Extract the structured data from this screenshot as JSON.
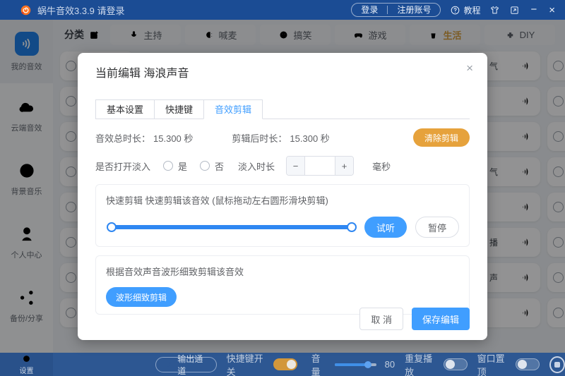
{
  "titlebar": {
    "title": "蜗牛音效3.3.9 请登录",
    "login": "登录",
    "register": "注册账号",
    "help": "教程",
    "icons": [
      "snail-logo",
      "question-circle-icon",
      "skin-theme-icon",
      "resize-window-icon",
      "minimize-icon",
      "close-icon"
    ]
  },
  "sidebar": {
    "items": [
      {
        "label": "我的音效",
        "icon": "sound-wave-icon",
        "active": true
      },
      {
        "label": "云端音效",
        "icon": "cloud-icon",
        "active": false
      },
      {
        "label": "背景音乐",
        "icon": "music-disc-icon",
        "active": false
      },
      {
        "label": "个人中心",
        "icon": "user-icon",
        "active": false
      },
      {
        "label": "备份/分享",
        "icon": "share-icon",
        "active": false
      }
    ]
  },
  "nav": {
    "category": "分类",
    "edit_icon": "edit-icon",
    "tabs": [
      {
        "label": "主持",
        "icon": "microphone-icon",
        "active": false
      },
      {
        "label": "喊麦",
        "icon": "horn-icon",
        "active": false
      },
      {
        "label": "搞笑",
        "icon": "smiley-icon",
        "active": false
      },
      {
        "label": "游戏",
        "icon": "gamepad-icon",
        "active": false
      },
      {
        "label": "生活",
        "icon": "cup-icon",
        "active": true
      },
      {
        "label": "DIY",
        "icon": "puzzle-icon",
        "active": false
      }
    ]
  },
  "cards": {
    "right_labels": [
      "气",
      "",
      "",
      "气",
      "",
      "播",
      "声",
      ""
    ],
    "speaker_icon": "sound-wave-icon",
    "play_icon": "play-circle-icon"
  },
  "modal": {
    "title": "当前编辑 海浪声音",
    "close": "×",
    "tabs": [
      {
        "label": "基本设置",
        "active": false
      },
      {
        "label": "快捷键",
        "active": false
      },
      {
        "label": "音效剪辑",
        "active": true
      }
    ],
    "total_label": "音效总时长：",
    "total_value": "15.300 秒",
    "edited_label": "剪辑后时长：",
    "edited_value": "15.300 秒",
    "clear_button": "清除剪辑",
    "fade_question": "是否打开淡入",
    "radio_yes": "是",
    "radio_no": "否",
    "fade_duration_label": "淡入时长",
    "fade_minus": "−",
    "fade_plus": "+",
    "fade_input_value": "",
    "fade_unit": "毫秒",
    "quick_title": "快速剪辑 快速剪辑该音效 (鼠标拖动左右圆形滑块剪辑)",
    "listen_button": "试听",
    "pause_button": "暂停",
    "wave_title": "根据音效声音波形细致剪辑该音效",
    "wave_button": "波形细致剪辑",
    "cancel_button": "取 消",
    "save_button": "保存编辑"
  },
  "bottombar": {
    "settings_label": "设置",
    "output_channel": "输出通道",
    "hotkey_label": "快捷键开关",
    "hotkey_on": true,
    "volume_label": "音量",
    "volume_value": "80",
    "volume_percent": 80,
    "repeat_label": "重复播放",
    "repeat_on": false,
    "topmost_label": "窗口置顶",
    "topmost_on": false,
    "stop_icon": "stop-circle-icon"
  },
  "colors": {
    "titlebar_blue": "#1b4c94",
    "bottombar_blue": "#2d5792",
    "accent_blue": "#409EFF",
    "warning_orange": "#E6A23C",
    "active_tile_blue": "#2080e8"
  }
}
